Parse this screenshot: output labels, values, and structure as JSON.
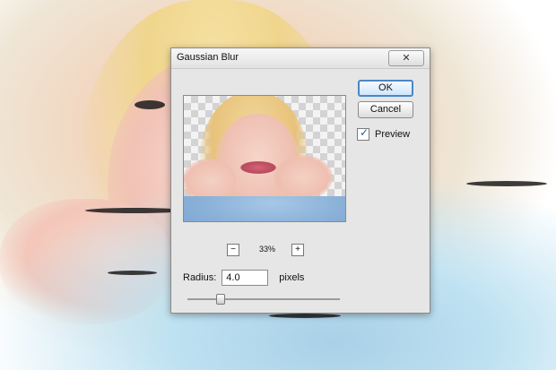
{
  "dialog": {
    "title": "Gaussian Blur",
    "close_icon": "close-icon",
    "buttons": {
      "ok": "OK",
      "cancel": "Cancel"
    },
    "preview_checkbox": {
      "label": "Preview",
      "checked": true
    },
    "zoom": {
      "minus": "−",
      "level": "33%",
      "plus": "+"
    },
    "radius": {
      "label": "Radius:",
      "value": "4.0",
      "unit": "pixels",
      "slider_fraction": 0.2
    }
  }
}
